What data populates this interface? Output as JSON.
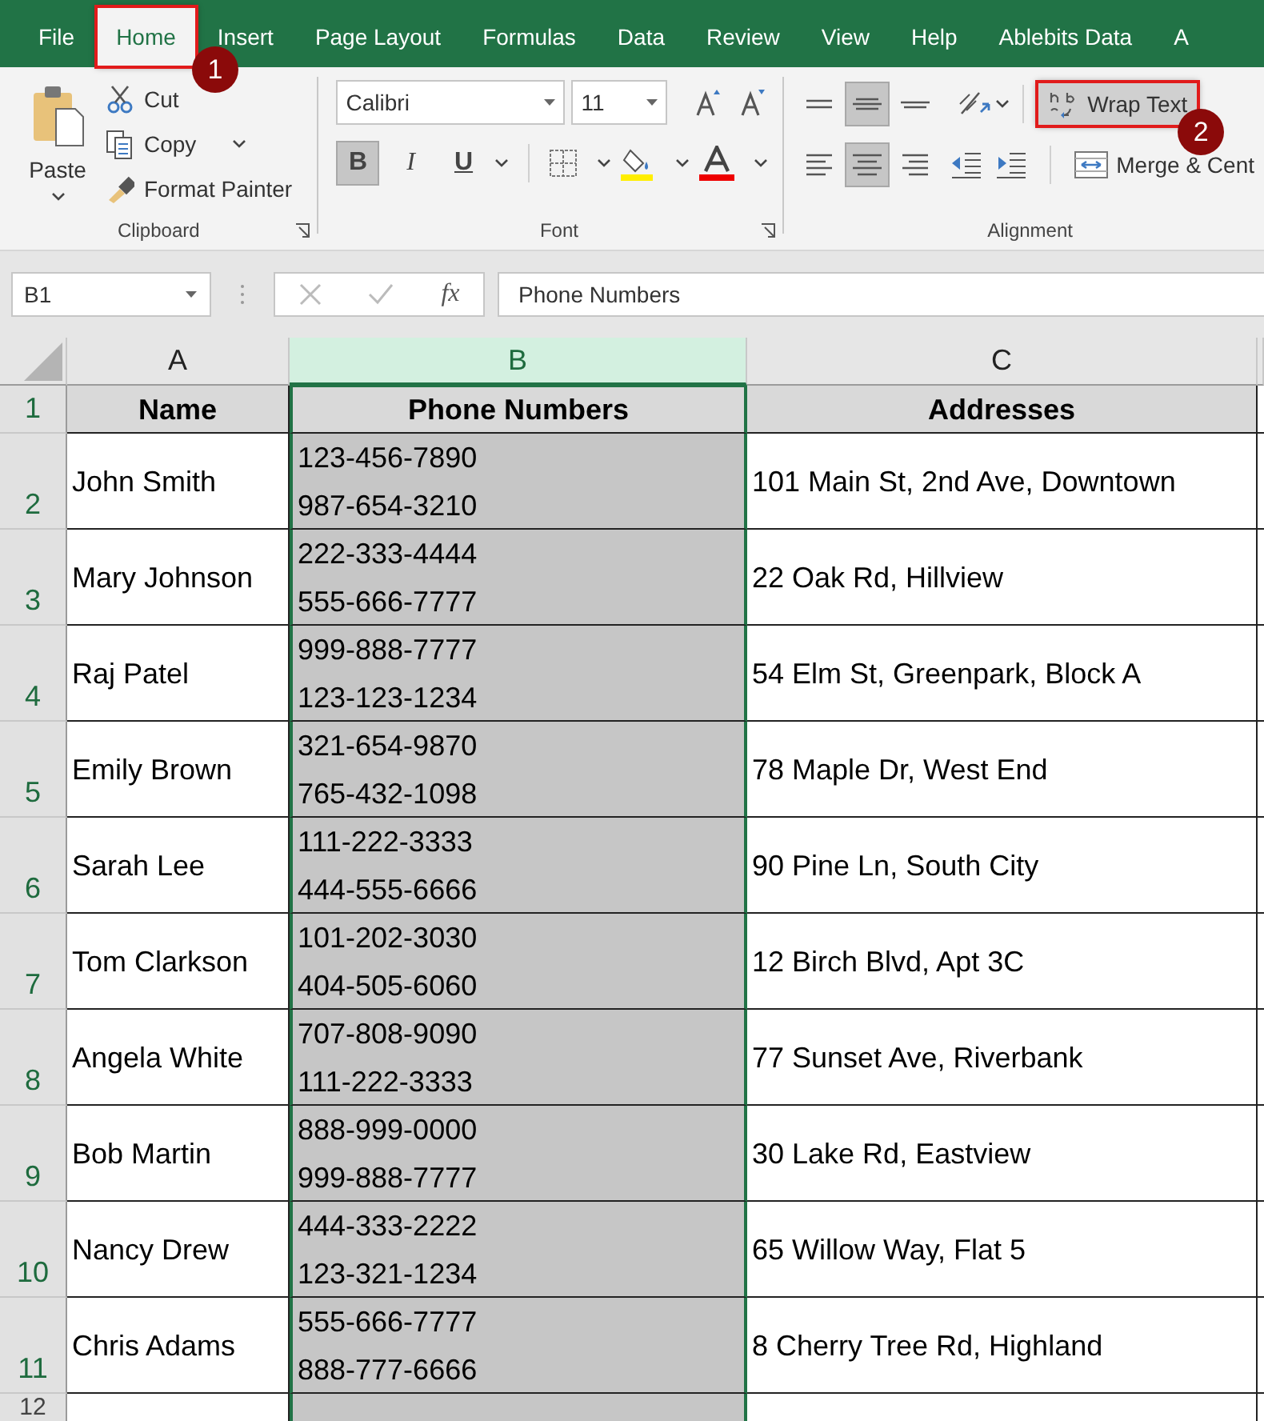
{
  "ribbon_tabs": [
    {
      "label": "File",
      "selected": false
    },
    {
      "label": "Home",
      "selected": true,
      "callout": "1"
    },
    {
      "label": "Insert",
      "selected": false
    },
    {
      "label": "Page Layout",
      "selected": false
    },
    {
      "label": "Formulas",
      "selected": false
    },
    {
      "label": "Data",
      "selected": false
    },
    {
      "label": "Review",
      "selected": false
    },
    {
      "label": "View",
      "selected": false
    },
    {
      "label": "Help",
      "selected": false
    },
    {
      "label": "Ablebits Data",
      "selected": false
    },
    {
      "label": "A",
      "selected": false
    }
  ],
  "clipboard": {
    "paste": "Paste",
    "actions": [
      {
        "kind": "cut",
        "label": "Cut"
      },
      {
        "kind": "copy",
        "label": "Copy"
      },
      {
        "kind": "painter",
        "label": "Format Painter"
      }
    ],
    "label": "Clipboard"
  },
  "font": {
    "name": "Calibri",
    "size": "11",
    "format_buttons": [
      {
        "kind": "bold",
        "label": "B",
        "selected": true
      },
      {
        "kind": "italic",
        "label": "I",
        "selected": false
      },
      {
        "kind": "underline",
        "label": "U",
        "selected": false
      }
    ],
    "label": "Font"
  },
  "alignment": {
    "vertical": [
      {
        "kind": "top",
        "selected": false
      },
      {
        "kind": "middle",
        "selected": true
      },
      {
        "kind": "bottom",
        "selected": false
      }
    ],
    "horizontal": [
      {
        "kind": "left",
        "selected": false
      },
      {
        "kind": "center",
        "selected": true
      },
      {
        "kind": "right",
        "selected": false
      }
    ],
    "wrap_text": {
      "label": "Wrap Text",
      "callout": "2"
    },
    "merge": {
      "label": "Merge & Cent"
    },
    "label": "Alignment"
  },
  "formula_bar": {
    "name_box": "B1",
    "function_label": "fx",
    "formula": "Phone Numbers"
  },
  "sheet": {
    "columns": [
      {
        "label": "A",
        "selected": false
      },
      {
        "label": "B",
        "selected": true
      },
      {
        "label": "C",
        "selected": false
      }
    ],
    "rows": [
      {
        "number": "1",
        "kind": "header",
        "cells": [
          "Name",
          "Phone Numbers",
          "Addresses"
        ]
      },
      {
        "number": "2",
        "kind": "data",
        "cells": [
          "John Smith",
          "123-456-7890\n987-654-3210",
          "101 Main St, 2nd Ave, Downtown"
        ]
      },
      {
        "number": "3",
        "kind": "data",
        "cells": [
          "Mary Johnson",
          "222-333-4444\n555-666-7777",
          "22 Oak Rd, Hillview"
        ]
      },
      {
        "number": "4",
        "kind": "data",
        "cells": [
          "Raj Patel",
          "999-888-7777\n123-123-1234",
          "54 Elm St, Greenpark, Block A"
        ]
      },
      {
        "number": "5",
        "kind": "data",
        "cells": [
          "Emily Brown",
          "321-654-9870\n765-432-1098",
          "78 Maple Dr, West End"
        ]
      },
      {
        "number": "6",
        "kind": "data",
        "cells": [
          "Sarah Lee",
          "111-222-3333\n444-555-6666",
          "90 Pine Ln, South City"
        ]
      },
      {
        "number": "7",
        "kind": "data",
        "cells": [
          "Tom Clarkson",
          "101-202-3030\n404-505-6060",
          "12 Birch Blvd, Apt 3C"
        ]
      },
      {
        "number": "8",
        "kind": "data",
        "cells": [
          "Angela White",
          "707-808-9090\n111-222-3333",
          "77 Sunset Ave, Riverbank"
        ]
      },
      {
        "number": "9",
        "kind": "data",
        "cells": [
          "Bob Martin",
          "888-999-0000\n999-888-7777",
          "30 Lake Rd, Eastview"
        ]
      },
      {
        "number": "10",
        "kind": "data",
        "cells": [
          "Nancy Drew",
          "444-333-2222\n123-321-1234",
          "65 Willow Way, Flat 5"
        ]
      },
      {
        "number": "11",
        "kind": "data",
        "cells": [
          "Chris Adams",
          "555-666-7777\n888-777-6666",
          "8 Cherry Tree Rd, Highland"
        ]
      },
      {
        "number": "12",
        "kind": "blank",
        "cells": []
      }
    ]
  }
}
